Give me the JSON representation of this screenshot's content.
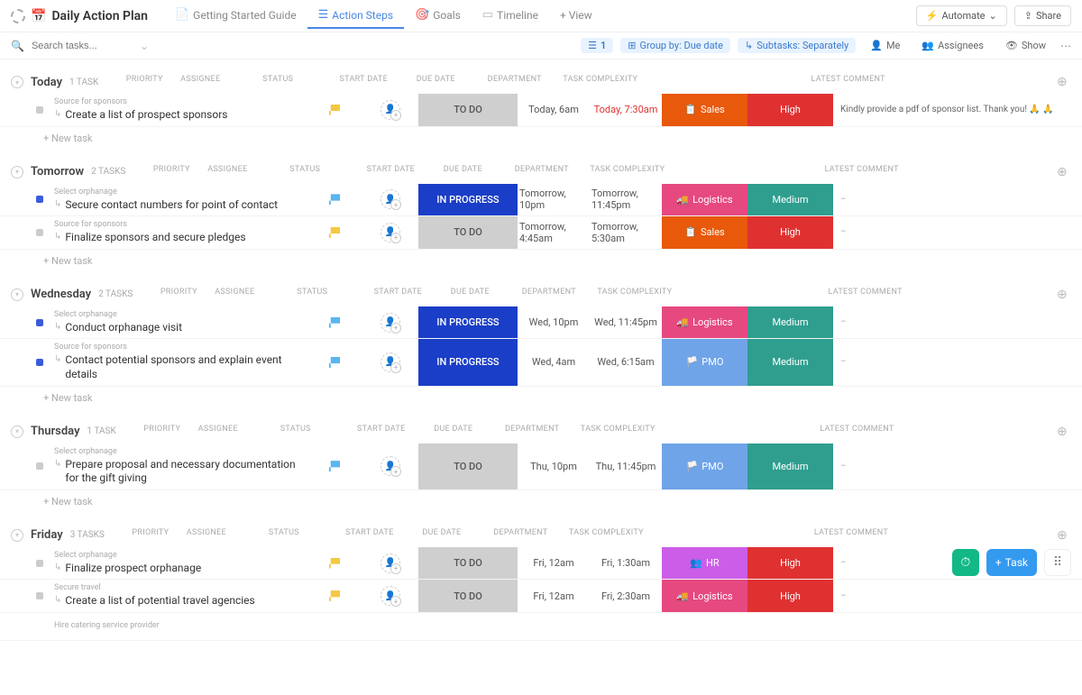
{
  "header": {
    "title": "Daily Action Plan",
    "tabs": [
      {
        "label": "Getting Started Guide",
        "active": false
      },
      {
        "label": "Action Steps",
        "active": true
      },
      {
        "label": "Goals",
        "active": false
      },
      {
        "label": "Timeline",
        "active": false
      }
    ],
    "addView": "+ View",
    "automate": "Automate",
    "share": "Share"
  },
  "toolbar": {
    "searchPlaceholder": "Search tasks...",
    "filterCount": "1",
    "groupBy": "Group by: Due date",
    "subtasks": "Subtasks: Separately",
    "me": "Me",
    "assignees": "Assignees",
    "show": "Show"
  },
  "columns": {
    "priority": "PRIORITY",
    "assignee": "ASSIGNEE",
    "status": "STATUS",
    "startDate": "START DATE",
    "dueDate": "DUE DATE",
    "department": "DEPARTMENT",
    "complexity": "TASK COMPLEXITY",
    "comment": "LATEST COMMENT"
  },
  "groups": [
    {
      "name": "Today",
      "count": "1 TASK",
      "tasks": [
        {
          "breadcrumb": "Source for sponsors",
          "title": "Create a list of prospect sponsors",
          "flag": "yellow",
          "status": "TO DO",
          "statusClass": "st-todo",
          "dotClass": "dot-gray",
          "start": "Today, 6am",
          "due": "Today, 7:30am",
          "dueOverdue": true,
          "dept": "Sales",
          "deptClass": "d-sales",
          "deptIcon": "📋",
          "complexity": "High",
          "compClass": "c-high",
          "comment": "Kindly provide a pdf of sponsor list. Thank you! 🙏 🙏"
        }
      ]
    },
    {
      "name": "Tomorrow",
      "count": "2 TASKS",
      "tasks": [
        {
          "breadcrumb": "Select orphanage",
          "title": "Secure contact numbers for point of contact",
          "flag": "blue",
          "status": "IN PROGRESS",
          "statusClass": "st-progress",
          "dotClass": "dot-blue",
          "start": "Tomorrow, 10pm",
          "due": "Tomorrow, 11:45pm",
          "dept": "Logistics",
          "deptClass": "d-logistics",
          "deptIcon": "🚚",
          "complexity": "Medium",
          "compClass": "c-medium",
          "comment": "–"
        },
        {
          "breadcrumb": "Source for sponsors",
          "title": "Finalize sponsors and secure pledges",
          "flag": "yellow",
          "status": "TO DO",
          "statusClass": "st-todo",
          "dotClass": "dot-gray",
          "start": "Tomorrow, 4:45am",
          "due": "Tomorrow, 5:30am",
          "dept": "Sales",
          "deptClass": "d-sales",
          "deptIcon": "📋",
          "complexity": "High",
          "compClass": "c-high",
          "comment": "–"
        }
      ]
    },
    {
      "name": "Wednesday",
      "count": "2 TASKS",
      "tasks": [
        {
          "breadcrumb": "Select orphanage",
          "title": "Conduct orphanage visit",
          "flag": "blue",
          "status": "IN PROGRESS",
          "statusClass": "st-progress",
          "dotClass": "dot-blue",
          "start": "Wed, 10pm",
          "due": "Wed, 11:45pm",
          "dept": "Logistics",
          "deptClass": "d-logistics",
          "deptIcon": "🚚",
          "complexity": "Medium",
          "compClass": "c-medium",
          "comment": "–"
        },
        {
          "breadcrumb": "Source for sponsors",
          "title": "Contact potential sponsors and explain event details",
          "flag": "blue",
          "status": "IN PROGRESS",
          "statusClass": "st-progress",
          "dotClass": "dot-blue",
          "start": "Wed, 4am",
          "due": "Wed, 6:15am",
          "dept": "PMO",
          "deptClass": "d-pmo",
          "deptIcon": "🏳️",
          "complexity": "Medium",
          "compClass": "c-medium",
          "comment": "–"
        }
      ]
    },
    {
      "name": "Thursday",
      "count": "1 TASK",
      "tasks": [
        {
          "breadcrumb": "Select orphanage",
          "title": "Prepare proposal and necessary documentation for the gift giving",
          "flag": "blue",
          "status": "TO DO",
          "statusClass": "st-todo",
          "dotClass": "dot-gray",
          "start": "Thu, 10pm",
          "due": "Thu, 11:45pm",
          "dept": "PMO",
          "deptClass": "d-pmo",
          "deptIcon": "🏳️",
          "complexity": "Medium",
          "compClass": "c-medium",
          "comment": "–"
        }
      ]
    },
    {
      "name": "Friday",
      "count": "3 TASKS",
      "tasks": [
        {
          "breadcrumb": "Select orphanage",
          "title": "Finalize prospect orphanage",
          "flag": "yellow",
          "status": "TO DO",
          "statusClass": "st-todo",
          "dotClass": "dot-gray",
          "start": "Fri, 12am",
          "due": "Fri, 1:30am",
          "dept": "HR",
          "deptClass": "d-hr",
          "deptIcon": "👥",
          "complexity": "High",
          "compClass": "c-high",
          "comment": "–"
        },
        {
          "breadcrumb": "Secure travel",
          "title": "Create a list of potential travel agencies",
          "flag": "yellow",
          "status": "TO DO",
          "statusClass": "st-todo",
          "dotClass": "dot-gray",
          "start": "Fri, 12am",
          "due": "Fri, 2:30am",
          "dept": "Logistics",
          "deptClass": "d-logistics",
          "deptIcon": "🚚",
          "complexity": "High",
          "compClass": "c-high",
          "comment": "–"
        },
        {
          "breadcrumb": "Hire catering service provider",
          "title": "",
          "flag": "",
          "status": "",
          "statusClass": "",
          "dotClass": "",
          "start": "",
          "due": "",
          "dept": "",
          "deptClass": "",
          "complexity": "",
          "compClass": "",
          "comment": ""
        }
      ]
    }
  ],
  "newTask": "+ New task",
  "fabTask": "Task"
}
